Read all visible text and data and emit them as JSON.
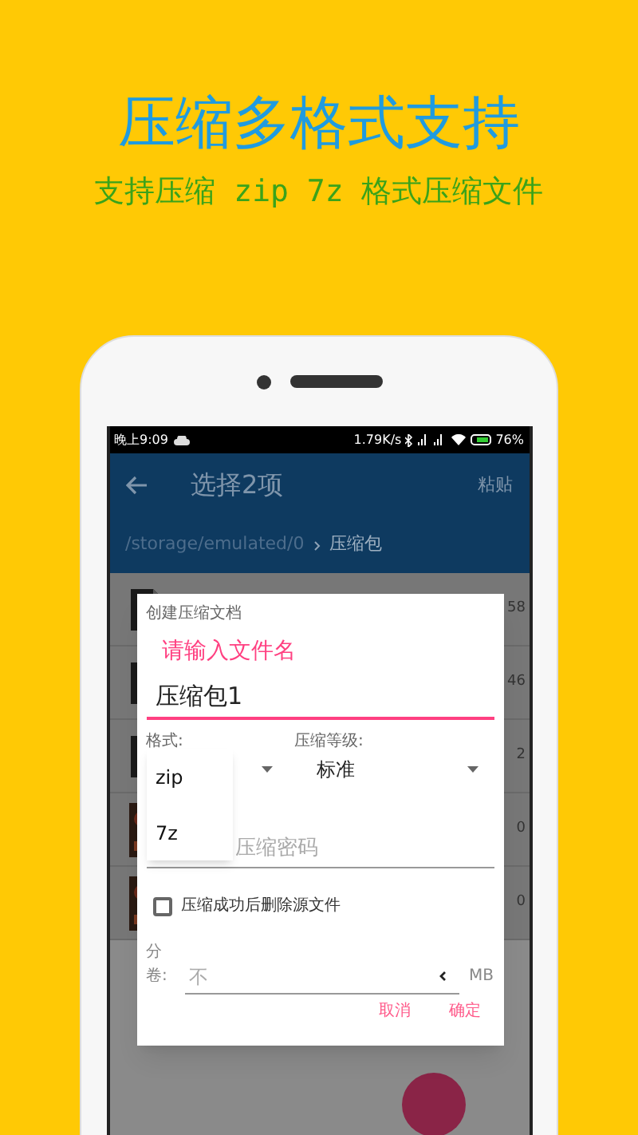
{
  "headline": "压缩多格式支持",
  "subheadline": "支持压缩 zip 7z 格式压缩文件",
  "status_bar": {
    "time": "晚上9:09",
    "speed": "1.79K/s",
    "battery": "76%"
  },
  "app_bar": {
    "title": "选择2项",
    "action": "粘贴"
  },
  "breadcrumb": [
    {
      "label": "/storage/emulated/0",
      "selected": false
    },
    {
      "label": "压缩包",
      "selected": true
    }
  ],
  "file_list": [
    {
      "kind": "document",
      "column_2": "58"
    },
    {
      "kind": "document",
      "column_2": "46"
    },
    {
      "kind": "document",
      "column_2": "2"
    },
    {
      "kind": "picture",
      "column_2": "0"
    },
    {
      "kind": "picture",
      "column_2": "0"
    }
  ],
  "dialog": {
    "title": "创建压缩文档",
    "name_label": "请输入文件名",
    "name_value": "压缩包1",
    "format_label": "格式:",
    "level_label": "压缩等级:",
    "level_value": "标准",
    "format_options": [
      {
        "label": "zip"
      },
      {
        "label": "7z"
      }
    ],
    "password_placeholder": "压缩密码",
    "delete_source": {
      "label": "压缩成功后删除源文件",
      "checked": false
    },
    "split_label": "分卷:",
    "split_placeholder": "不",
    "split_unit": "MB",
    "buttons": [
      "取消",
      "确定"
    ]
  }
}
